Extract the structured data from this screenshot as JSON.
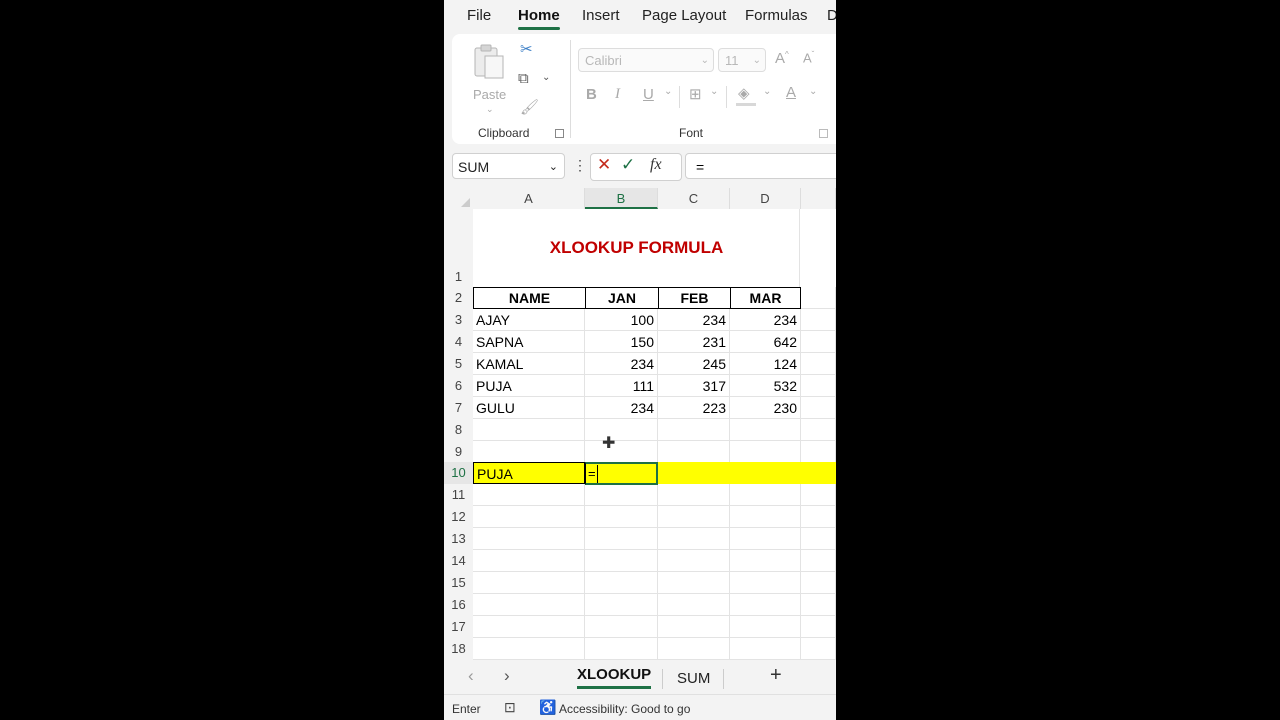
{
  "ribbon_tabs": [
    "File",
    "Home",
    "Insert",
    "Page Layout",
    "Formulas",
    "D"
  ],
  "clipboard": {
    "paste_label": "Paste",
    "group_label": "Clipboard"
  },
  "font": {
    "name_value": "Calibri",
    "size_value": "11",
    "group_label": "Font",
    "bold": "B",
    "italic": "I",
    "underline": "U",
    "grow": "A",
    "shrink": "A",
    "font_color": "A"
  },
  "formula_bar": {
    "name_box": "SUM",
    "fx_label": "fx",
    "formula": "="
  },
  "columns": [
    "A",
    "B",
    "C",
    "D"
  ],
  "sheet": {
    "title": "XLOOKUP FORMULA",
    "header": [
      "NAME",
      "JAN",
      "FEB",
      "MAR"
    ],
    "rows": [
      [
        "AJAY",
        "100",
        "234",
        "234"
      ],
      [
        "SAPNA",
        "150",
        "231",
        "642"
      ],
      [
        "KAMAL",
        "234",
        "245",
        "124"
      ],
      [
        "PUJA",
        "111",
        "317",
        "532"
      ],
      [
        "GULU",
        "234",
        "223",
        "230"
      ]
    ],
    "lookup_name": "PUJA",
    "editing_value": "=",
    "row_numbers": [
      "1",
      "2",
      "3",
      "4",
      "5",
      "6",
      "7",
      "8",
      "9",
      "10",
      "11",
      "12",
      "13",
      "14",
      "15",
      "16",
      "17",
      "18"
    ]
  },
  "sheet_tabs": {
    "active": "XLOOKUP",
    "other": "SUM",
    "add": "+"
  },
  "status": {
    "mode": "Enter",
    "accessibility": "Accessibility: Good to go"
  },
  "colors": {
    "accent": "#1e7145",
    "highlight": "#ffff00",
    "title": "#c00000"
  }
}
